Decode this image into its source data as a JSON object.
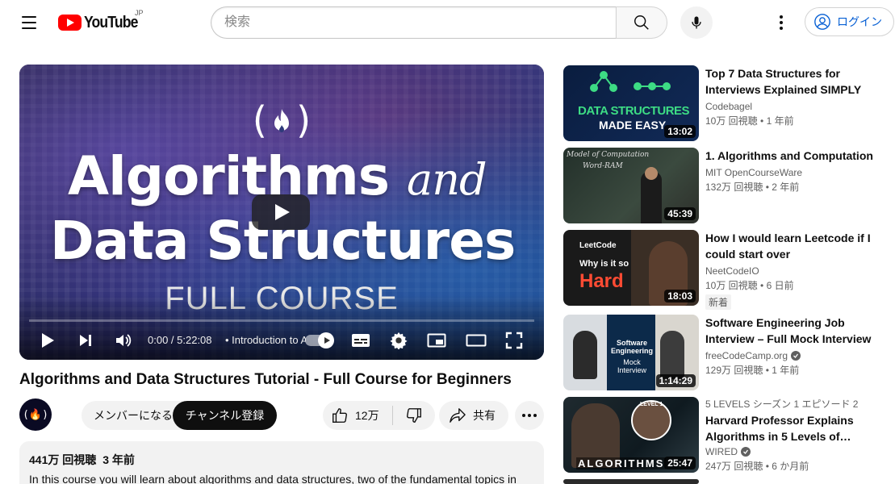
{
  "header": {
    "logo_text": "YouTube",
    "region": "JP",
    "search_placeholder": "検索",
    "signin_label": "ログイン"
  },
  "player": {
    "thumb_line1": "Algorithms",
    "thumb_and": "and",
    "thumb_line2": "Data Structures",
    "thumb_line3": "FULL COURSE",
    "thumb_logo": "( )",
    "time": "0:00 / 5:22:08",
    "chapter": "• Introduction to A",
    "progress": 0
  },
  "video": {
    "title": "Algorithms and Data Structures Tutorial - Full Course for Beginners",
    "member_label": "メンバーになる",
    "subscribe_label": "チャンネル登録",
    "likes": "12万",
    "share_label": "共有",
    "views": "441万 回視聴",
    "age": "3 年前",
    "description": "In this course you will learn about algorithms and data structures, two of the fundamental topics in"
  },
  "related": [
    {
      "title": "Top 7 Data Structures for Interviews Explained SIMPLY",
      "channel": "Codebagel",
      "views": "10万 回視聴",
      "age": "1 年前",
      "duration": "13:02",
      "thumb_text1": "DATA STRUCTURES",
      "thumb_text2": "MADE EASY"
    },
    {
      "title": "1. Algorithms and Computation",
      "channel": "MIT OpenCourseWare",
      "views": "132万 回視聴",
      "age": "2 年前",
      "duration": "45:39",
      "thumb_text1": "Model of Computation",
      "thumb_text2": "Word-RAM"
    },
    {
      "title": "How I would learn Leetcode if I could start over",
      "channel": "NeetCodeIO",
      "views": "10万 回視聴",
      "age": "6 日前",
      "duration": "18:03",
      "badge": "新着",
      "thumb_text1": "LeetCode",
      "thumb_text2": "Why is it so",
      "thumb_text3": "Hard"
    },
    {
      "title": "Software Engineering Job Interview – Full Mock Interview",
      "channel": "freeCodeCamp.org",
      "views": "129万 回視聴",
      "age": "1 年前",
      "duration": "1:14:29",
      "thumb_text1": "Software Engineering",
      "thumb_text2": "Mock Interview"
    },
    {
      "kicker": "5 LEVELS  シーズン 1 エピソード 2",
      "title": "Harvard Professor Explains Algorithms in 5 Levels of…",
      "channel": "WIRED",
      "views": "247万 回視聴",
      "age": "6 か月前",
      "duration": "25:47",
      "thumb_text1": "ALGORITHMS",
      "thumb_text2": "LEVEL 1"
    }
  ],
  "colors": {
    "brand_red": "#ff0000",
    "link_blue": "#065fd4",
    "chip_bg": "#f2f2f2"
  }
}
